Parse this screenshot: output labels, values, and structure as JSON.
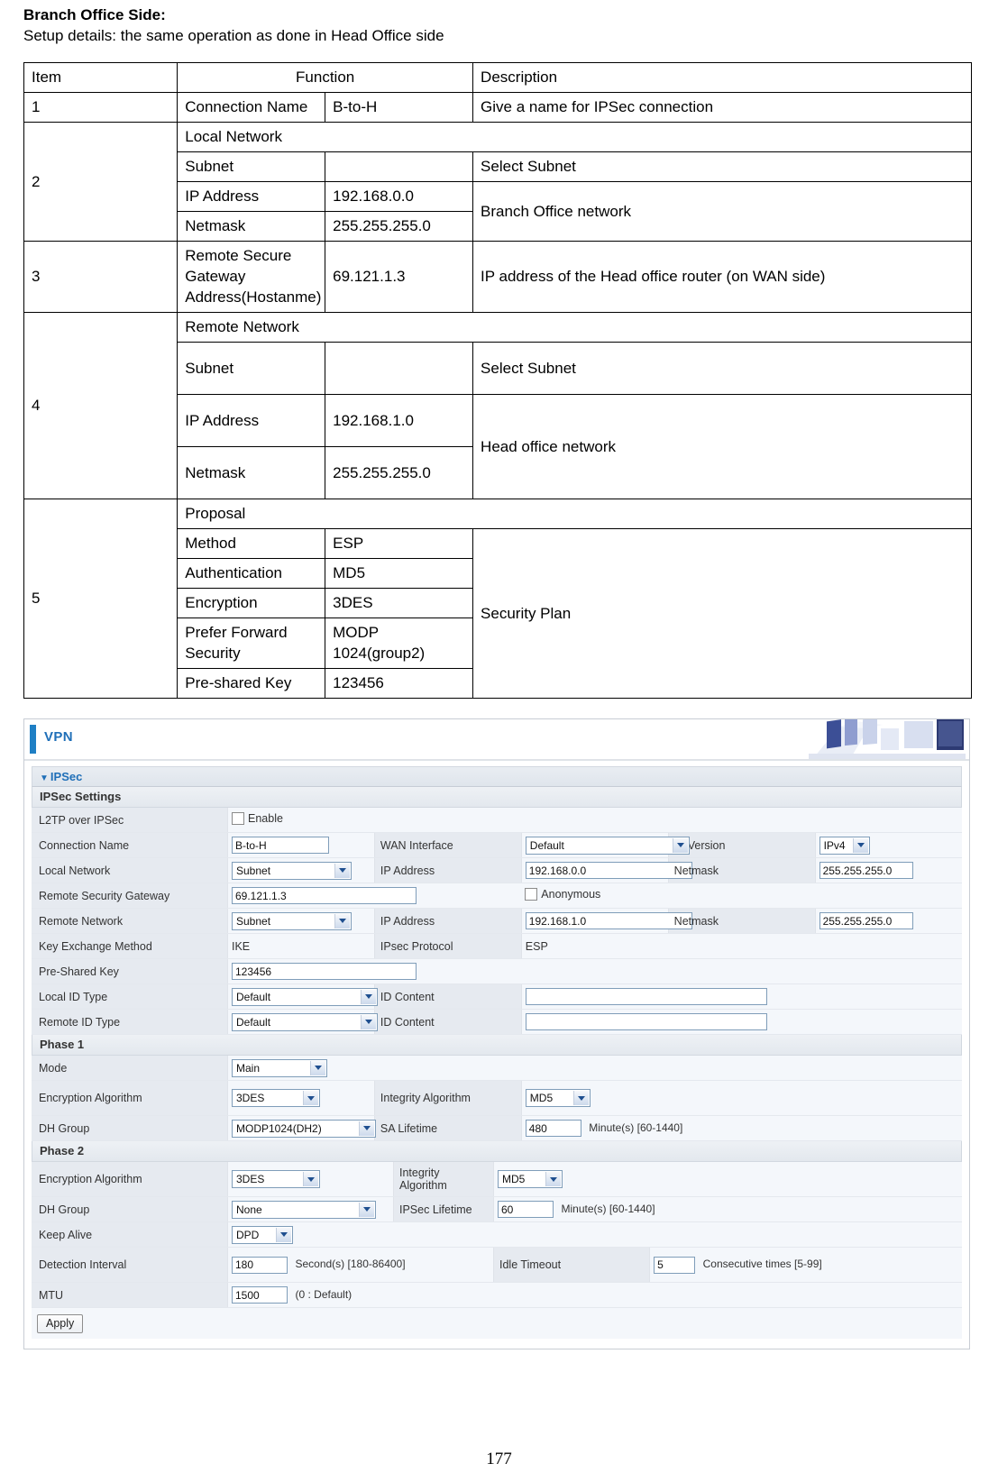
{
  "document": {
    "heading": "Branch Office Side:",
    "subheading": "Setup details: the same operation as done in Head Office side",
    "page_number": "177"
  },
  "spec_table": {
    "headers": {
      "item": "Item",
      "function": "Function",
      "description": "Description"
    },
    "rows": [
      {
        "item": "1",
        "function_label": "Connection Name",
        "function_value": "B-to-H",
        "description": "Give a name for IPSec connection"
      },
      {
        "item": "2",
        "group_title": "Local Network",
        "sub": [
          {
            "label": "Subnet",
            "value": "",
            "description": "Select Subnet"
          },
          {
            "label": "IP Address",
            "value": "192.168.0.0",
            "description": "Branch Office network"
          },
          {
            "label": "Netmask",
            "value": "255.255.255.0",
            "description": ""
          }
        ]
      },
      {
        "item": "3",
        "function_label": "Remote Secure Gateway Address(Hostanme)",
        "function_value": "69.121.1.3",
        "description": "IP address of the Head office router (on WAN side)"
      },
      {
        "item": "4",
        "group_title": "Remote Network",
        "sub": [
          {
            "label": "Subnet",
            "value": "",
            "description": "Select Subnet"
          },
          {
            "label": "IP Address",
            "value": "192.168.1.0",
            "description": "Head office network"
          },
          {
            "label": "Netmask",
            "value": "255.255.255.0",
            "description": ""
          }
        ]
      },
      {
        "item": "5",
        "group_title": "Proposal",
        "sub": [
          {
            "label": "Method",
            "value": "ESP",
            "description": "Security Plan"
          },
          {
            "label": "Authentication",
            "value": "MD5",
            "description": ""
          },
          {
            "label": "Encryption",
            "value": "3DES",
            "description": ""
          },
          {
            "label": "Prefer Forward Security",
            "value": "MODP 1024(group2)",
            "description": ""
          },
          {
            "label": "Pre-shared Key",
            "value": "123456",
            "description": ""
          }
        ]
      }
    ]
  },
  "router_ui": {
    "banner_title": "VPN",
    "section_title": "IPSec",
    "settings_title": "IPSec Settings",
    "fields": {
      "l2tp_label": "L2TP over IPSec",
      "l2tp_enable_label": "Enable",
      "connection_name_label": "Connection Name",
      "connection_name_value": "B-to-H",
      "wan_interface_label": "WAN Interface",
      "wan_interface_value": "Default",
      "ip_version_label": "IP Version",
      "ip_version_value": "IPv4",
      "local_network_label": "Local Network",
      "local_network_value": "Subnet",
      "local_ip_label": "IP Address",
      "local_ip_value": "192.168.0.0",
      "local_netmask_label": "Netmask",
      "local_netmask_value": "255.255.255.0",
      "remote_gateway_label": "Remote Security Gateway",
      "remote_gateway_value": "69.121.1.3",
      "anonymous_label": "Anonymous",
      "remote_network_label": "Remote Network",
      "remote_network_value": "Subnet",
      "remote_ip_label": "IP Address",
      "remote_ip_value": "192.168.1.0",
      "remote_netmask_label": "Netmask",
      "remote_netmask_value": "255.255.255.0",
      "key_exchange_label": "Key Exchange Method",
      "key_exchange_value": "IKE",
      "ipsec_protocol_label": "IPsec Protocol",
      "ipsec_protocol_value": "ESP",
      "preshared_key_label": "Pre-Shared Key",
      "preshared_key_value": "123456",
      "local_id_type_label": "Local ID Type",
      "local_id_type_value": "Default",
      "local_id_content_label": "ID Content",
      "local_id_content_value": "",
      "remote_id_type_label": "Remote ID Type",
      "remote_id_type_value": "Default",
      "remote_id_content_label": "ID Content",
      "remote_id_content_value": ""
    },
    "phase1": {
      "title": "Phase 1",
      "mode_label": "Mode",
      "mode_value": "Main",
      "encryption_label": "Encryption Algorithm",
      "encryption_value": "3DES",
      "integrity_label": "Integrity Algorithm",
      "integrity_value": "MD5",
      "dh_group_label": "DH Group",
      "dh_group_value": "MODP1024(DH2)",
      "sa_lifetime_label": "SA Lifetime",
      "sa_lifetime_value": "480",
      "sa_lifetime_hint": "Minute(s) [60-1440]"
    },
    "phase2": {
      "title": "Phase 2",
      "encryption_label": "Encryption Algorithm",
      "encryption_value": "3DES",
      "integrity_label": "Integrity Algorithm",
      "integrity_value": "MD5",
      "dh_group_label": "DH Group",
      "dh_group_value": "None",
      "ipsec_lifetime_label": "IPSec Lifetime",
      "ipsec_lifetime_value": "60",
      "ipsec_lifetime_hint": "Minute(s) [60-1440]",
      "keep_alive_label": "Keep Alive",
      "keep_alive_value": "DPD",
      "detection_interval_label": "Detection Interval",
      "detection_interval_value": "180",
      "detection_interval_hint": "Second(s) [180-86400]",
      "idle_timeout_label": "Idle Timeout",
      "idle_timeout_value": "5",
      "idle_timeout_hint": "Consecutive times [5-99]",
      "mtu_label": "MTU",
      "mtu_value": "1500",
      "mtu_hint": "(0 : Default)"
    },
    "apply_label": "Apply",
    "colors": {
      "accent": "#1f6fb8",
      "header_bg": "#e6eaf0",
      "row_bg": "#f4f7fb"
    }
  }
}
